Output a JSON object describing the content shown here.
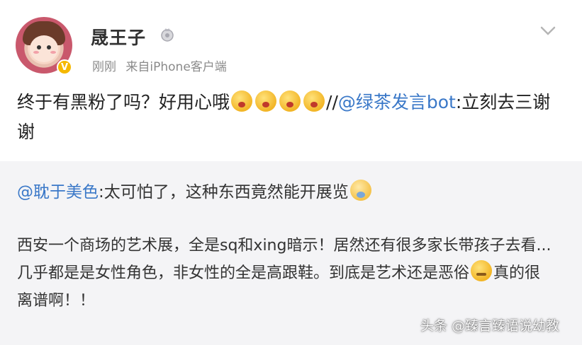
{
  "post": {
    "username": "晟王子",
    "member_icon": "member-badge-icon",
    "verified_badge": "V",
    "time": "刚刚",
    "source": "来自iPhone客户端",
    "text_before": "终于有黑粉了吗？好用心哦",
    "text_sep": "//",
    "mention": "@绿茶发言bot",
    "text_after": ":立刻去三谢谢",
    "emoji_icon": "blowing-kiss-emoji-icon",
    "emoji_count": 4
  },
  "repost": {
    "mention": "@耽于美色",
    "line1": ":太可怕了，这种东西竟然能开展览",
    "line1_emoji": "scared-emoji-icon",
    "body_part1": "西安一个商场的艺术展，全是sq和xing暗示！居然还有很多家长带孩子去看...几乎都是是女性角色，非女性的全是高跟鞋。到底是艺术还是恶俗",
    "body_emoji": "smug-emoji-icon",
    "body_part2": "真的很离谱啊！！"
  },
  "watermark": "头条 @臻言臻语说幼教",
  "colors": {
    "link": "#3a78c8",
    "repost_bg": "#f4f4f6",
    "meta": "#8a8a8a",
    "verified": "#f5b800"
  }
}
